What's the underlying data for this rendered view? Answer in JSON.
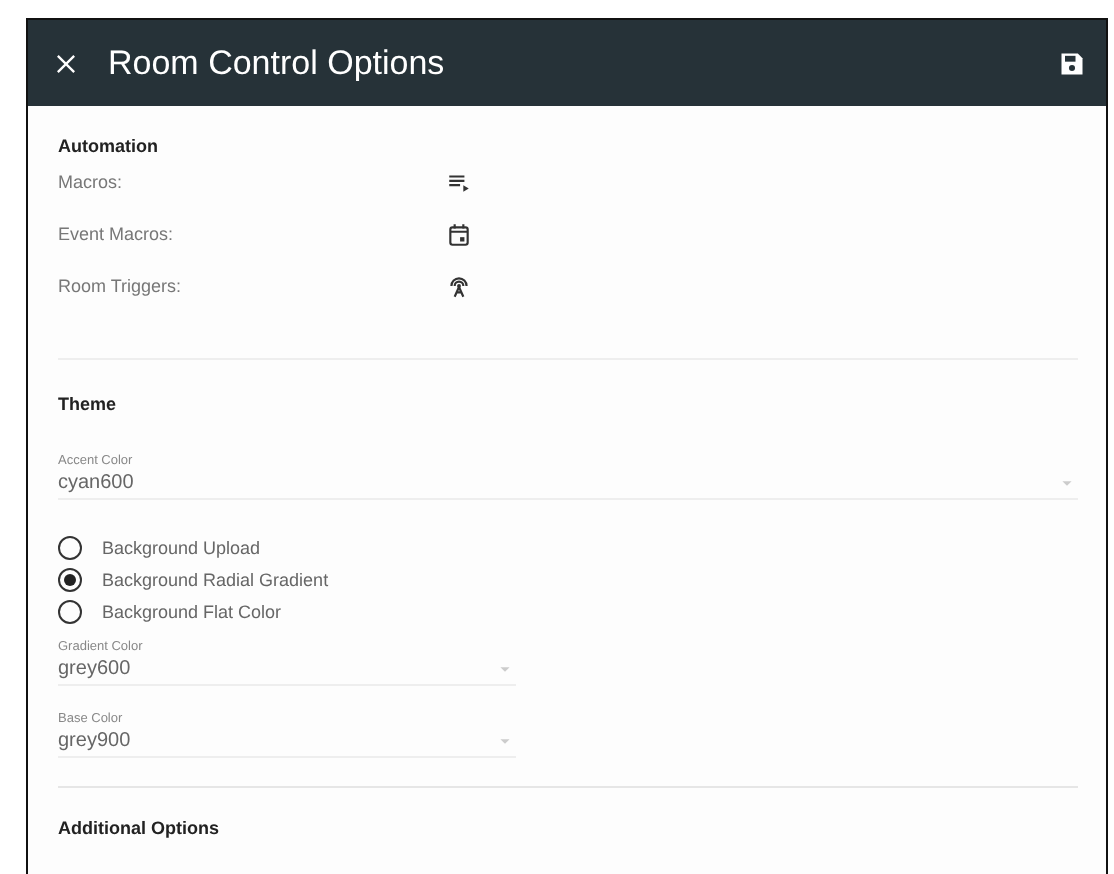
{
  "window": {
    "title": "Room Control Options"
  },
  "automation": {
    "heading": "Automation",
    "rows": [
      {
        "label": "Macros:",
        "kind": "playlist"
      },
      {
        "label": "Event Macros:",
        "kind": "event"
      },
      {
        "label": "Room Triggers:",
        "kind": "antenna"
      }
    ]
  },
  "theme": {
    "heading": "Theme",
    "accent": {
      "label": "Accent Color",
      "value": "cyan600"
    },
    "background_options": [
      {
        "label": "Background Upload",
        "selected": false
      },
      {
        "label": "Background Radial Gradient",
        "selected": true
      },
      {
        "label": "Background Flat Color",
        "selected": false
      }
    ],
    "gradient": {
      "label": "Gradient Color",
      "value": "grey600"
    },
    "base": {
      "label": "Base Color",
      "value": "grey900"
    }
  },
  "additional": {
    "heading": "Additional Options"
  }
}
